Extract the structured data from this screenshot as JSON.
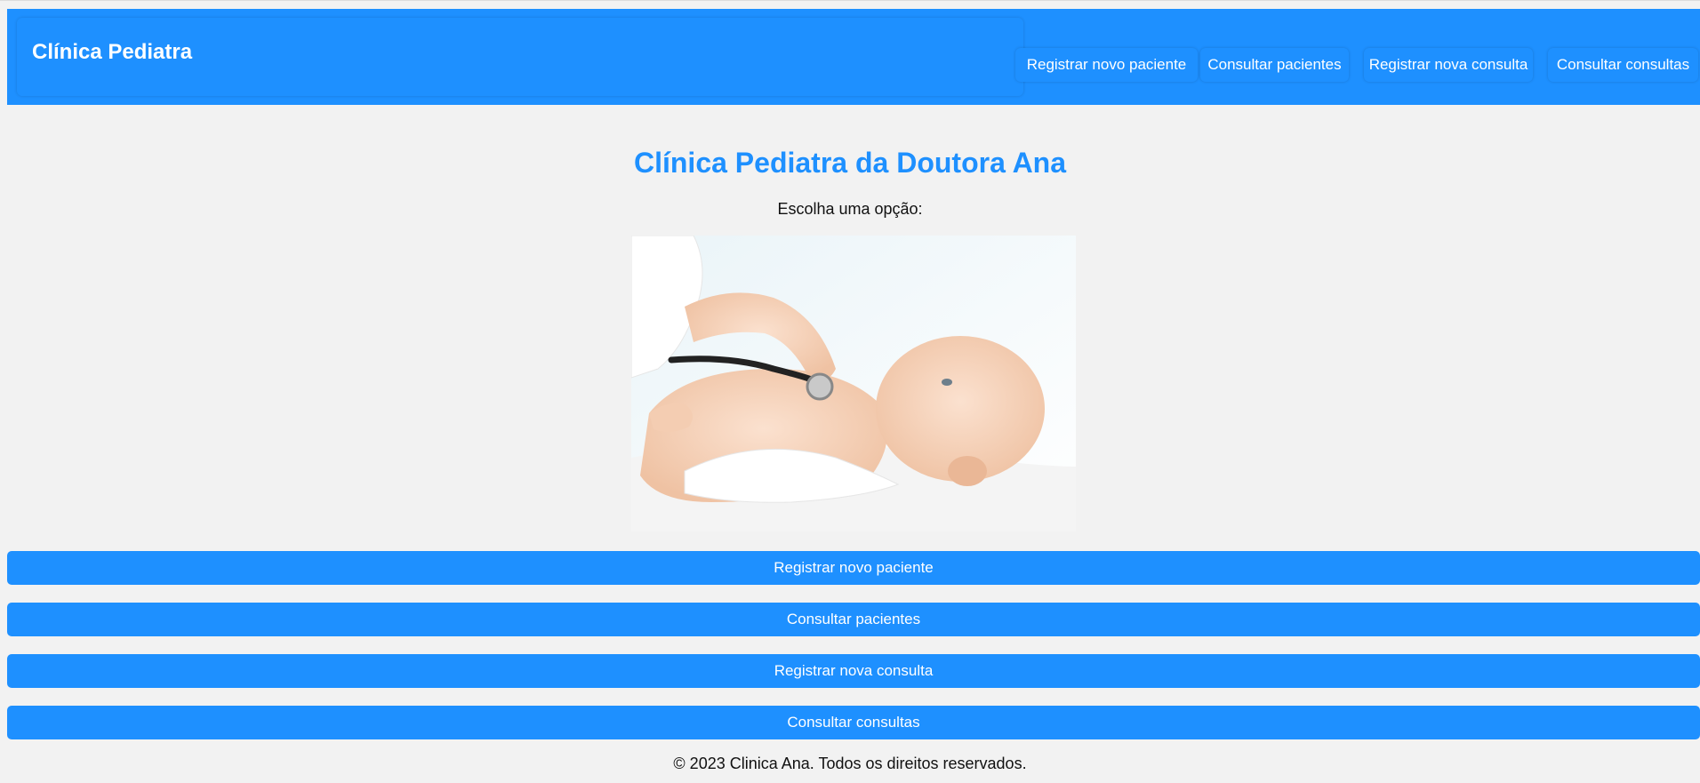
{
  "navbar": {
    "brand": "Clínica Pediatra",
    "links": [
      "Registrar novo paciente",
      "Consultar pacientes",
      "Registrar nova consulta",
      "Consultar consultas"
    ]
  },
  "main": {
    "title": "Clínica Pediatra da Doutora Ana",
    "subtitle": "Escolha uma opção:",
    "image_icon": "baby-stethoscope-photo",
    "buttons": [
      "Registrar novo paciente",
      "Consultar pacientes",
      "Registrar nova consulta",
      "Consultar consultas"
    ]
  },
  "footer": {
    "text": "© 2023 Clinica Ana. Todos os direitos reservados."
  },
  "colors": {
    "primary": "#1e90ff",
    "background": "#f2f2f2",
    "button_text": "#ffffff"
  }
}
